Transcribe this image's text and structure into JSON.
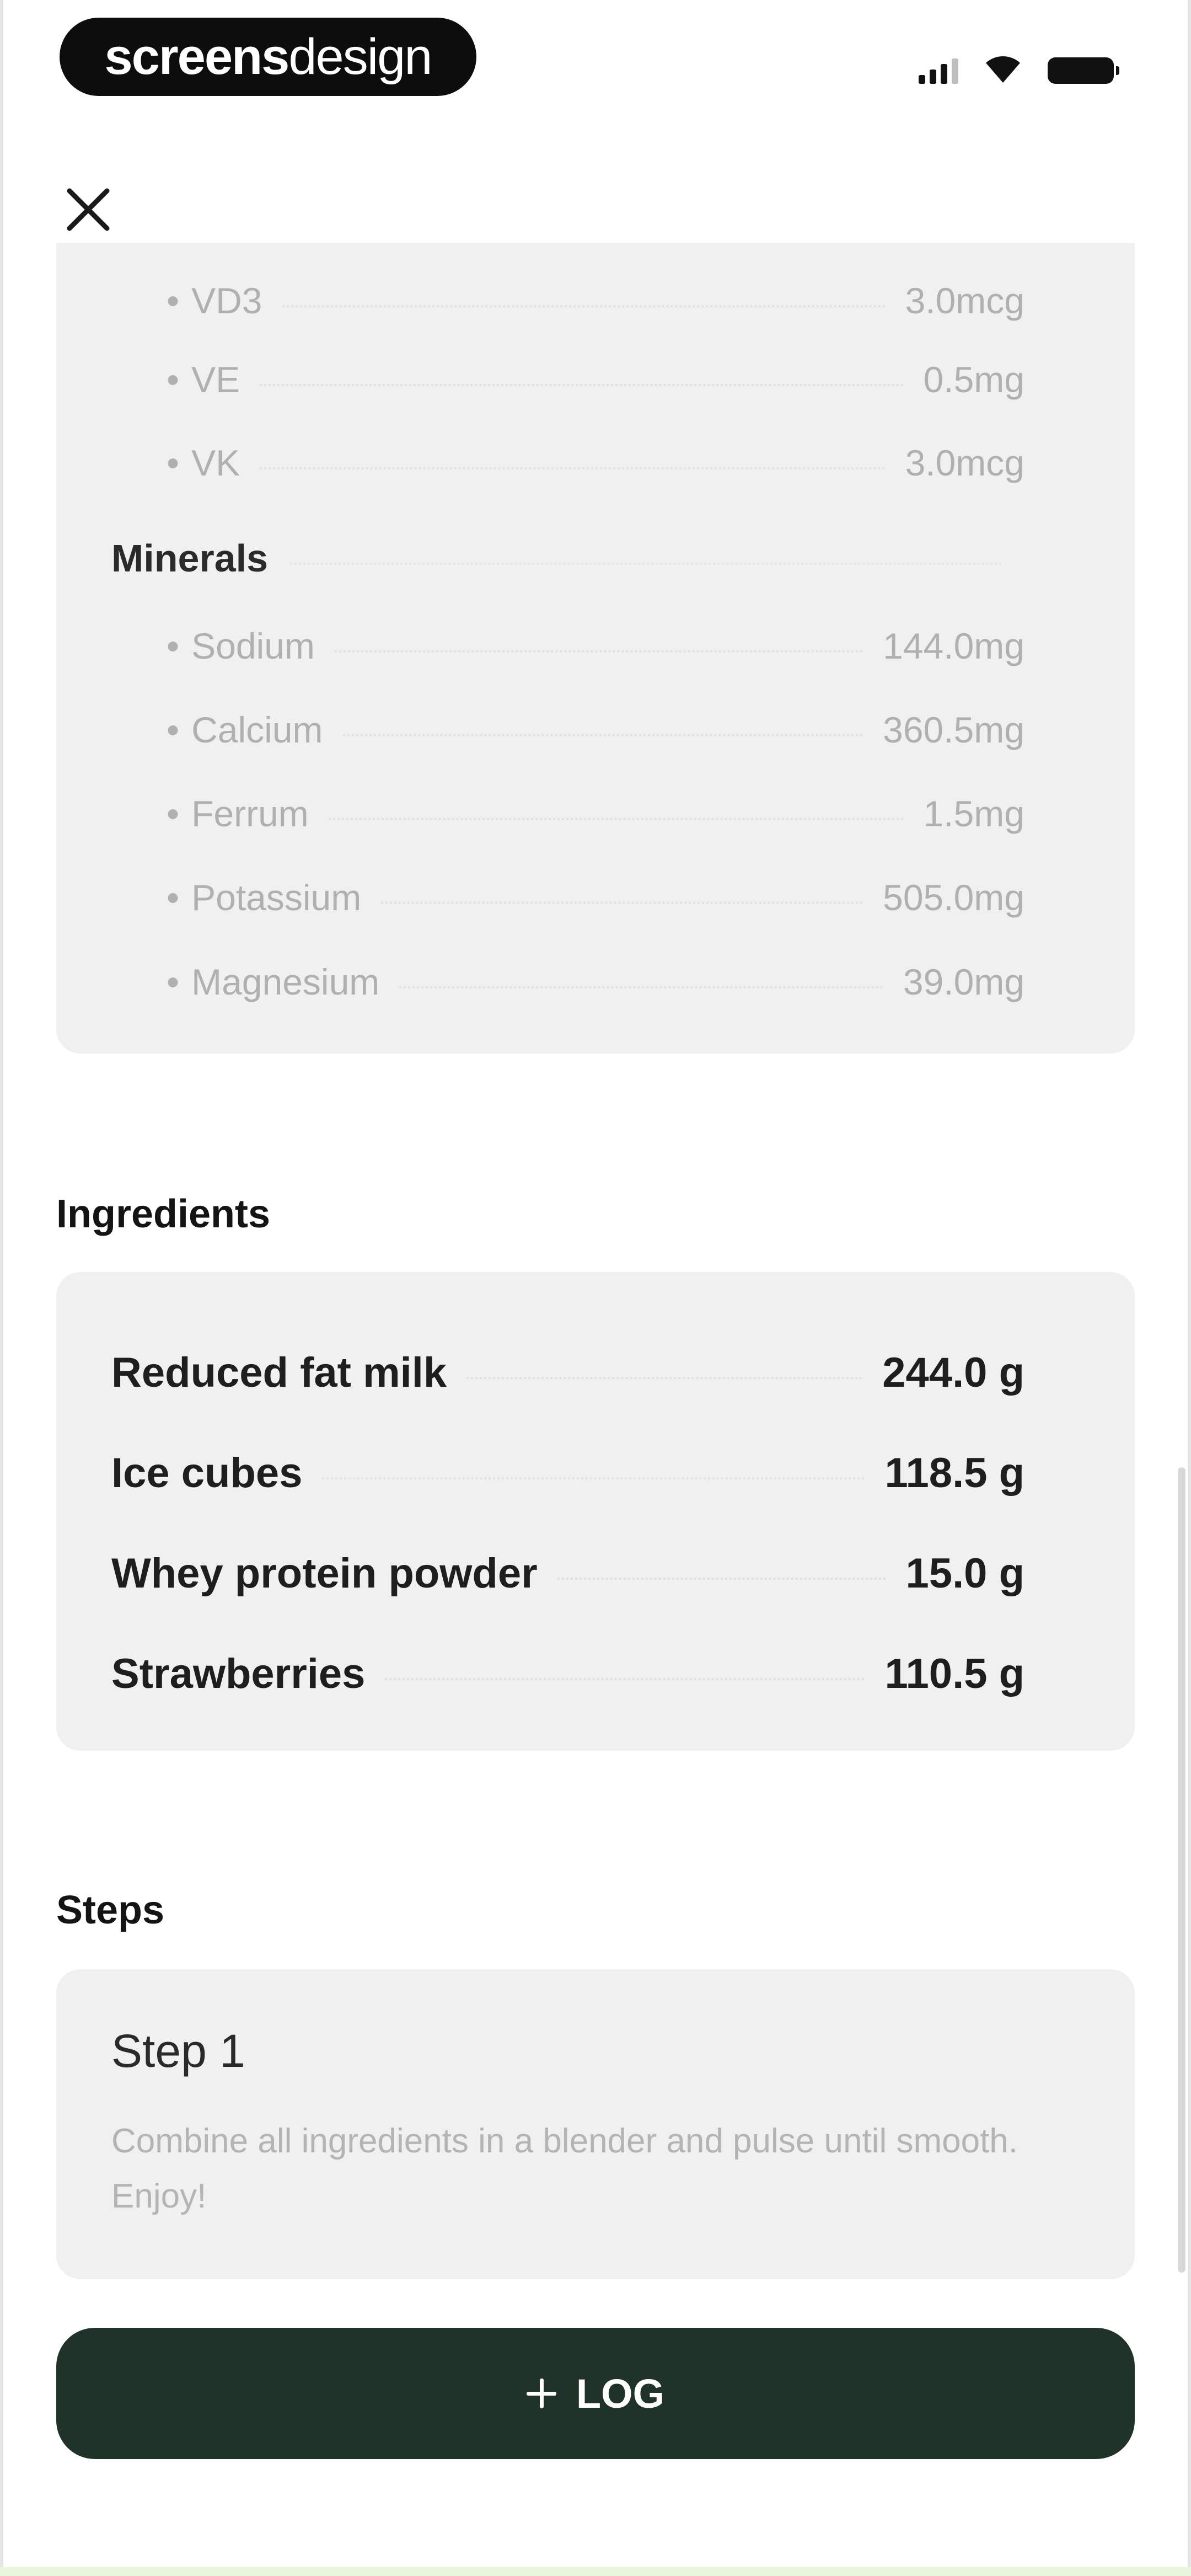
{
  "status_bar": {
    "brand_bold": "screens",
    "brand_light": "design"
  },
  "vitamins": [
    {
      "name": "VD3",
      "value": "3.0mcg"
    },
    {
      "name": "VE",
      "value": "0.5mg"
    },
    {
      "name": "VK",
      "value": "3.0mcg"
    }
  ],
  "minerals": {
    "label": "Minerals",
    "items": [
      {
        "name": "Sodium",
        "value": "144.0mg"
      },
      {
        "name": "Calcium",
        "value": "360.5mg"
      },
      {
        "name": "Ferrum",
        "value": "1.5mg"
      },
      {
        "name": "Potassium",
        "value": "505.0mg"
      },
      {
        "name": "Magnesium",
        "value": "39.0mg"
      }
    ]
  },
  "ingredients": {
    "heading": "Ingredients",
    "items": [
      {
        "name": "Reduced fat milk",
        "amount": "244.0 g"
      },
      {
        "name": "Ice cubes",
        "amount": "118.5 g"
      },
      {
        "name": "Whey protein powder",
        "amount": "15.0 g"
      },
      {
        "name": "Strawberries",
        "amount": "110.5 g"
      }
    ]
  },
  "steps": {
    "heading": "Steps",
    "items": [
      {
        "title": "Step 1",
        "text": "Combine all ingredients in a blender and pulse until smooth. Enjoy!"
      }
    ]
  },
  "actions": {
    "log_label": "LOG"
  },
  "colors": {
    "card_bg": "#f0f0f0",
    "accent_dark_green": "#1f3329"
  },
  "icons": {
    "close": "close-icon",
    "add": "plus-icon",
    "signal": "cellular-signal-icon",
    "wifi": "wifi-icon",
    "battery": "battery-icon"
  }
}
